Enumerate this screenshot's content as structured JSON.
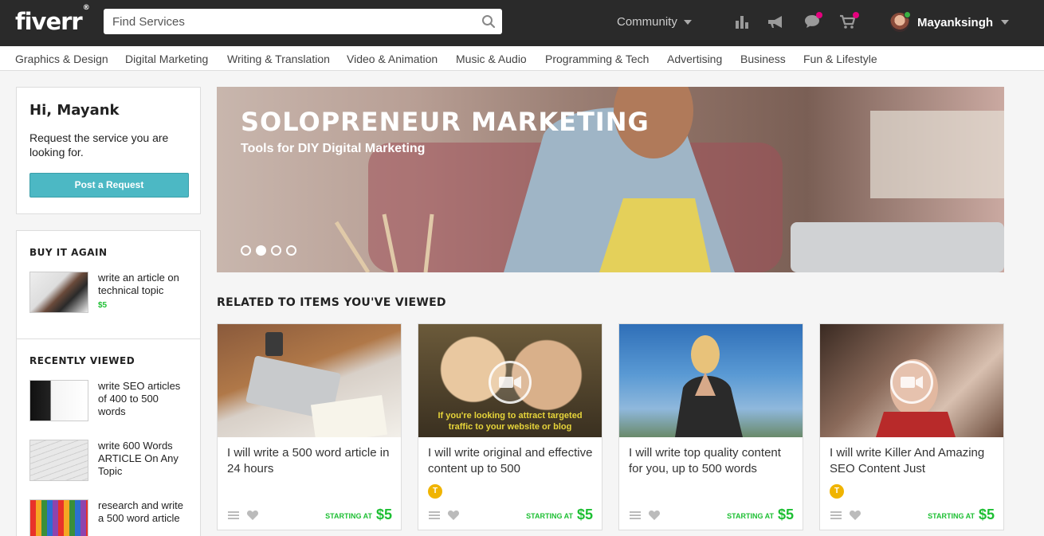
{
  "header": {
    "logo": "fiverr",
    "logo_mark": "®",
    "search_placeholder": "Find Services",
    "community_label": "Community",
    "username": "Mayanksingh"
  },
  "categories": [
    "Graphics & Design",
    "Digital Marketing",
    "Writing & Translation",
    "Video & Animation",
    "Music & Audio",
    "Programming & Tech",
    "Advertising",
    "Business",
    "Fun & Lifestyle"
  ],
  "sidebar": {
    "greeting": "Hi, Mayank",
    "request_text": "Request the service you are looking for.",
    "post_request_label": "Post a Request",
    "buy_again": {
      "heading": "BUY IT AGAIN",
      "items": [
        {
          "title": "write an article on technical topic",
          "price": "$5"
        }
      ]
    },
    "recently_viewed": {
      "heading": "RECENTLY VIEWED",
      "items": [
        {
          "title": "write SEO articles of 400 to 500 words"
        },
        {
          "title": "write 600 Words ARTICLE On Any Topic"
        },
        {
          "title": "research and write a 500 word article"
        }
      ]
    }
  },
  "hero": {
    "title": "SOLOPRENEUR MARKETING",
    "subtitle": "Tools for DIY Digital Marketing",
    "slides": 4,
    "active_slide": 2
  },
  "related": {
    "heading": "RELATED TO ITEMS YOU'VE VIEWED",
    "starting_label": "STARTING AT",
    "gigs": [
      {
        "title": "I will write a 500 word article in 24 hours",
        "price": "$5",
        "top_rated": false,
        "video": false
      },
      {
        "title": "I will write original and effective content up to 500",
        "price": "$5",
        "top_rated": true,
        "video": true,
        "overlay": "If you're looking to attract targeted traffic to your website or blog"
      },
      {
        "title": "I will write top quality content for you, up to 500 words",
        "price": "$5",
        "top_rated": false,
        "video": false
      },
      {
        "title": "I will write Killer And Amazing SEO Content Just",
        "price": "$5",
        "top_rated": true,
        "video": true
      }
    ],
    "badge_letter": "T"
  },
  "colors": {
    "topbar": "#2a2a2a",
    "accent_green": "#1dbf33",
    "button_teal": "#4cb8c4",
    "notify_pink": "#e5007e"
  }
}
